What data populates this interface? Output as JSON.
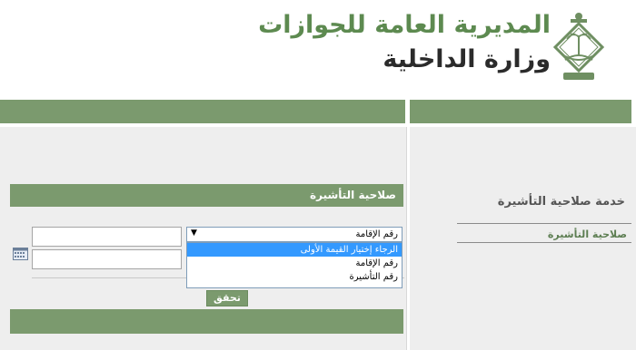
{
  "header": {
    "title_main": "المديرية العامة للجوازات",
    "title_sub": "وزارة الداخلية"
  },
  "right_panel": {
    "service_title": "خدمة صلاحية التأشيرة",
    "link_label": "صلاحية التأشيرة"
  },
  "form": {
    "section_title": "صلاحية التأشيرة",
    "select": {
      "selected_value": "رقم الإقامة",
      "options": [
        "الرجاء إختيار القيمة الأولى",
        "رقم الإقامة",
        "رقم التأشيرة"
      ],
      "highlighted_index": 0
    },
    "input1_value": "",
    "input2_value": "",
    "verify_label": "تحقق"
  },
  "icons": {
    "emblem": "moi-emblem-icon",
    "calendar": "calendar-icon",
    "select_arrow": "dropdown-arrow-icon"
  },
  "colors": {
    "green": "#7b9a6e",
    "title_green": "#5d8a50",
    "panel_grey": "#eeeeee",
    "highlight": "#3399ff"
  }
}
